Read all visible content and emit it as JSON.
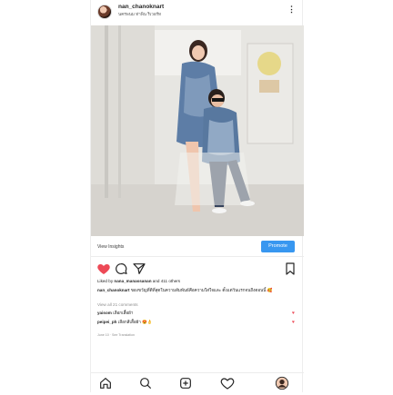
{
  "post": {
    "username": "nan_chanoknart",
    "location": "นครพนม ท่าพิน ริเวอร์ท",
    "more_icon": "more-vertical-icon"
  },
  "insights": {
    "view_label": "View Insights",
    "promote_label": "Promote"
  },
  "actions": {
    "like_icon": "heart-filled-icon",
    "comment_icon": "comment-icon",
    "share_icon": "send-icon",
    "save_icon": "bookmark-icon",
    "like_color": "#ed4956"
  },
  "likes": {
    "prefix": "Liked by",
    "user": "nana_manassanan",
    "suffix": "and 411 others"
  },
  "caption": {
    "user": "nan_chanoknart",
    "text": "ของขวัญที่ดีที่สุดในความสัมพันธ์คือความใส่ใจและ ตั้งแต่วันแรกจนถึงตอนนี้ 🥰"
  },
  "comments": {
    "view_all": "View all 21 comments",
    "items": [
      {
        "user": "yaisom",
        "text": "เลือกเสื้อผ้า"
      },
      {
        "user": "peipei_ph",
        "text": "เลือกสีเสื้อผ้า 😍👌"
      }
    ]
  },
  "timestamp": "June 10 · See Translation",
  "nav": {
    "home_icon": "home-icon",
    "search_icon": "search-icon",
    "add_icon": "add-post-icon",
    "activity_icon": "heart-outline-icon",
    "profile_icon": "profile-avatar-icon"
  }
}
